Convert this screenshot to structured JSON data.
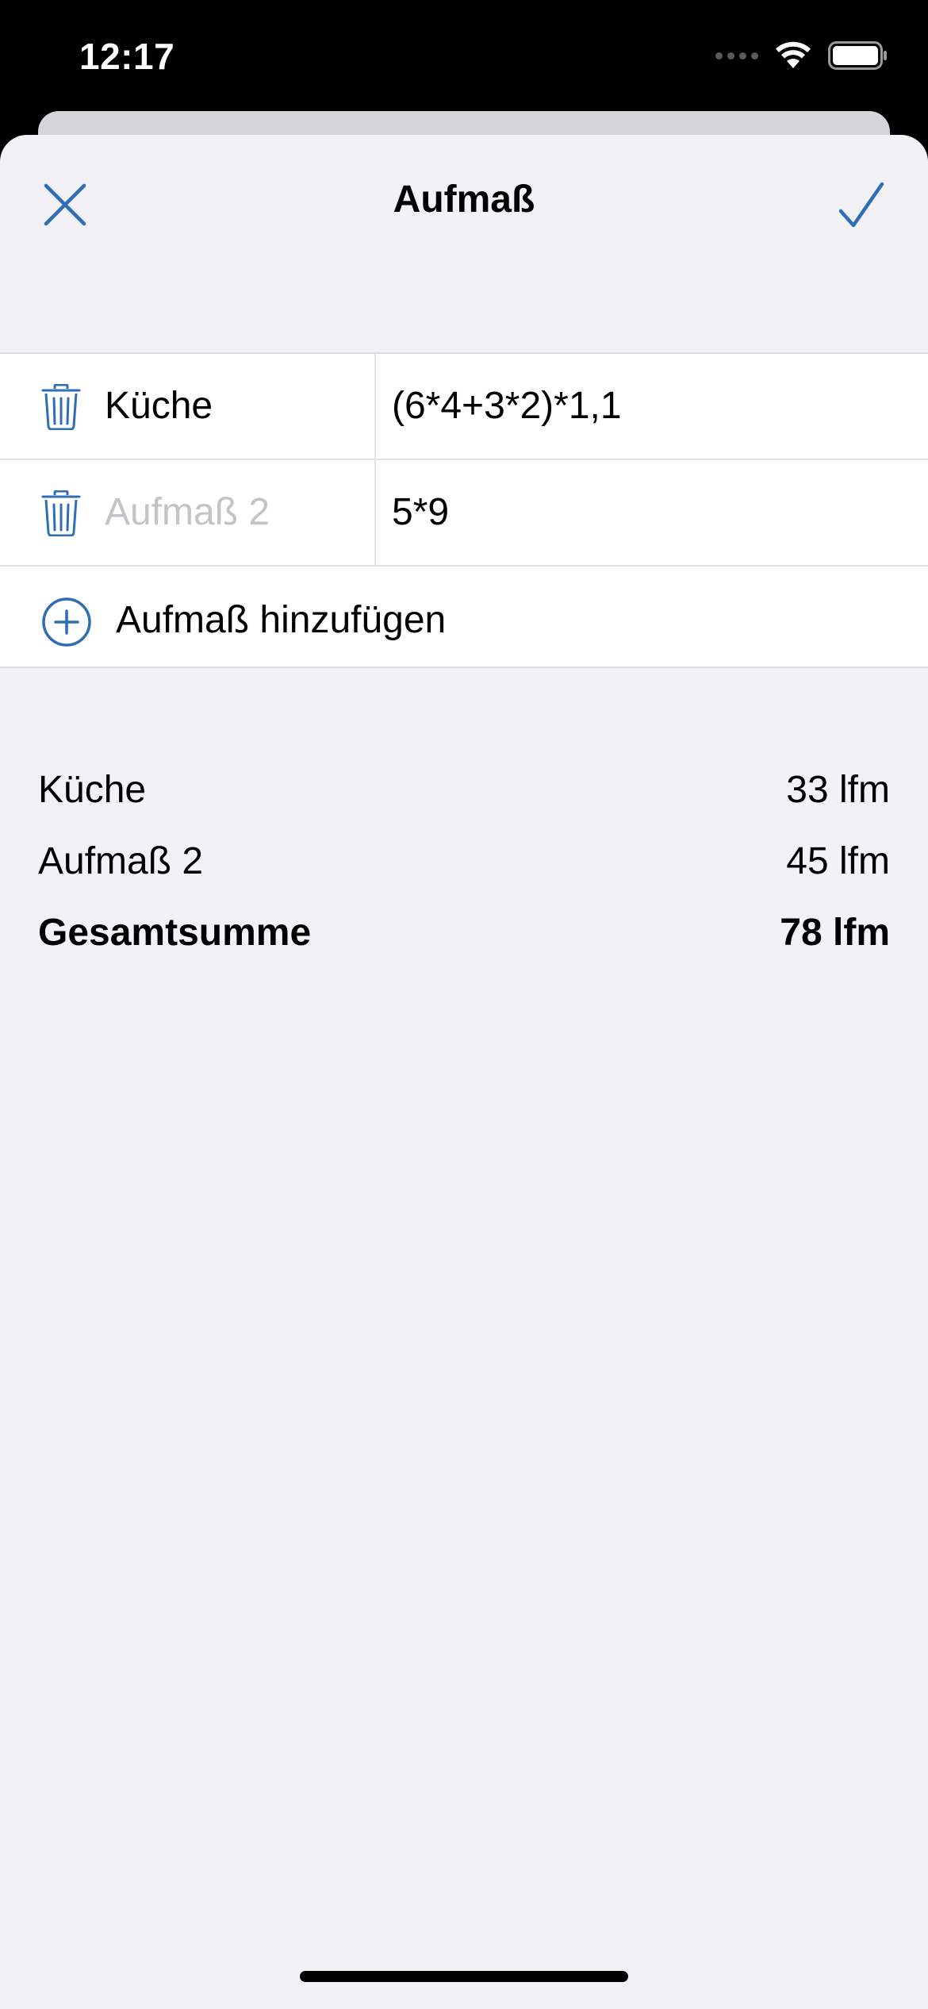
{
  "status_bar": {
    "time": "12:17",
    "icons": [
      "cellular-dots-icon",
      "wifi-icon",
      "battery-icon"
    ]
  },
  "nav": {
    "title": "Aufmaß",
    "close_icon": "close-icon",
    "confirm_icon": "checkmark-icon"
  },
  "measurements": {
    "rows": [
      {
        "name": "Küche",
        "is_placeholder": false,
        "formula": "(6*4+3*2)*1,1"
      },
      {
        "name": "Aufmaß 2",
        "is_placeholder": true,
        "formula": "5*9"
      }
    ],
    "add_label": "Aufmaß hinzufügen"
  },
  "summary": {
    "items": [
      {
        "label": "Küche",
        "value": "33 lfm"
      },
      {
        "label": "Aufmaß 2",
        "value": "45 lfm"
      }
    ],
    "total": {
      "label": "Gesamtsumme",
      "value": "78 lfm"
    }
  },
  "colors": {
    "accent": "#2f6db5",
    "background": "#f1f1f6",
    "placeholder": "#c4c4c8"
  }
}
